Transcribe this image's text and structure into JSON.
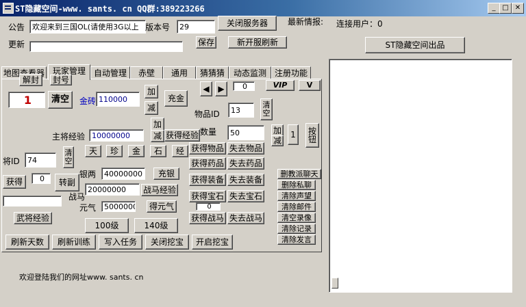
{
  "window": {
    "title": "ST隐藏空间-www. sants. cn  QQ群:389223266",
    "controls": [
      "_",
      "□",
      "✕"
    ]
  },
  "header": {
    "announce_label": "公告",
    "announce_value": "欢迎来到三国OL(请使用3G以上",
    "version_label": "版本号",
    "version_value": "29",
    "close_server_button": "关闭服务器",
    "latest_info_label": "最新情报:",
    "connected_users_label": "连接用户：0",
    "update_label": "更新",
    "update_value": "",
    "save_button": "保存",
    "new_server_refresh_button": "新开服刷新",
    "credit_button": "ST隐藏空间出品"
  },
  "tabs": [
    {
      "label": "地图查看器"
    },
    {
      "label": "玩家管理"
    },
    {
      "label": "自动管理"
    },
    {
      "label": "赤壁"
    },
    {
      "label": "通用"
    },
    {
      "label": "猜猜猜"
    },
    {
      "label": "动态监测"
    },
    {
      "label": "注册功能"
    }
  ],
  "player": {
    "unseal_button": "解封",
    "seal_button": "封号",
    "prev_arrow": "◀",
    "next_arrow": "▶",
    "page_value": "0",
    "vip_button": "VIP",
    "v_button": "V",
    "player_value": "1",
    "clear_button": "清空",
    "gold_label": "金砖",
    "gold_value": "110000",
    "add_button": "加",
    "sub_button": "减",
    "recharge_button": "充金",
    "item_id_label": "物品ID",
    "item_id_value": "13",
    "item_clear_button": "清空",
    "main_exp_label": "主将经验",
    "main_exp_value": "10000000",
    "exp_add_button": "加",
    "exp_sub_button": "减",
    "get_exp_button": "获得经验",
    "qty_label": "数量",
    "qty_value": "50",
    "qty_add_button": "加",
    "qty_sub_button": "减",
    "one_button": "1",
    "press_button": "按钮",
    "cat_tian": "天",
    "cat_zhen": "珍",
    "cat_jin": "金",
    "cat_shi": "石",
    "cat_jing": "经",
    "get_item": "获得物品",
    "lose_item": "失去物品",
    "get_medicine": "获得药品",
    "lose_medicine": "失去药品",
    "general_id_label": "将ID",
    "general_id_value": "74",
    "general_clear_button": "清空",
    "silver_label": "银两",
    "silver_value": "40000000",
    "charge_silver_button": "充银",
    "obtain_button": "获得",
    "obtain_value": "0",
    "deputy_button": "转副",
    "warhorse_value": "20000000",
    "warhorse_label": "战马",
    "warhorse_exp_button": "战马经验",
    "get_equip": "获得装备",
    "lose_equip": "失去装备",
    "get_gem": "获得宝石",
    "lose_gem": "失去宝石",
    "blank_input": "",
    "yuanqi_label": "元气",
    "yuanqi_value": "5000000",
    "get_yuanqi_button": "得元气",
    "small_value": "0",
    "get_warhorse": "获得战马",
    "lose_warhorse": "失去战马",
    "general_exp_button": "武将经验",
    "lv100_button": "100级",
    "lv140_button": "140级",
    "refresh_days": "刷新天数",
    "refresh_training": "刷新训练",
    "write_task": "写入任务",
    "close_dig": "关闭挖宝",
    "open_dig": "开启挖宝"
  },
  "side_buttons": [
    {
      "label": "删教派聊天"
    },
    {
      "label": "删除私聊"
    },
    {
      "label": "清除声望"
    },
    {
      "label": "清除邮件"
    },
    {
      "label": "清空录像"
    },
    {
      "label": "清除记录"
    },
    {
      "label": "清除发言"
    }
  ],
  "footer": {
    "welcome": "欢迎登陆我们的网址www. sants. cn"
  }
}
